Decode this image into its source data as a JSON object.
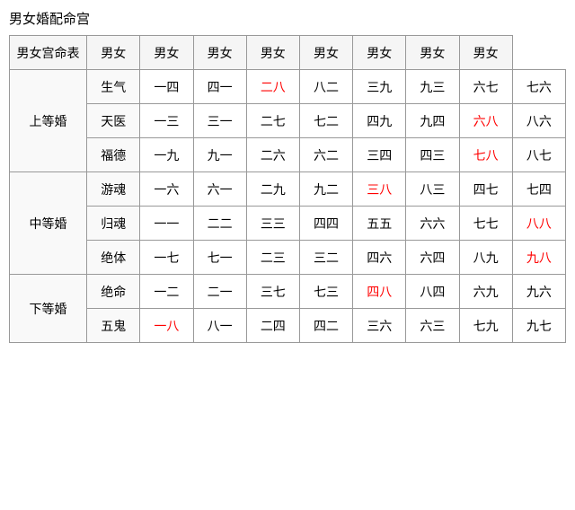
{
  "title": "男女婚配命宫",
  "table": {
    "headers": [
      "男女宫命表",
      "男女",
      "男女",
      "男女",
      "男女",
      "男女",
      "男女",
      "男女",
      "男女"
    ],
    "groups": [
      {
        "group_label": "上等婚",
        "rows": [
          {
            "row_label": "生气",
            "cells": [
              {
                "text": "一四",
                "red": false
              },
              {
                "text": "四一",
                "red": false
              },
              {
                "text": "二八",
                "red": true
              },
              {
                "text": "八二",
                "red": false
              },
              {
                "text": "三九",
                "red": false
              },
              {
                "text": "九三",
                "red": false
              },
              {
                "text": "六七",
                "red": false
              },
              {
                "text": "七六",
                "red": false
              }
            ]
          },
          {
            "row_label": "天医",
            "cells": [
              {
                "text": "一三",
                "red": false
              },
              {
                "text": "三一",
                "red": false
              },
              {
                "text": "二七",
                "red": false
              },
              {
                "text": "七二",
                "red": false
              },
              {
                "text": "四九",
                "red": false
              },
              {
                "text": "九四",
                "red": false
              },
              {
                "text": "六八",
                "red": true
              },
              {
                "text": "八六",
                "red": false
              }
            ]
          },
          {
            "row_label": "福德",
            "cells": [
              {
                "text": "一九",
                "red": false
              },
              {
                "text": "九一",
                "red": false
              },
              {
                "text": "二六",
                "red": false
              },
              {
                "text": "六二",
                "red": false
              },
              {
                "text": "三四",
                "red": false
              },
              {
                "text": "四三",
                "red": false
              },
              {
                "text": "七八",
                "red": true
              },
              {
                "text": "八七",
                "red": false
              }
            ]
          }
        ]
      },
      {
        "group_label": "中等婚",
        "rows": [
          {
            "row_label": "游魂",
            "cells": [
              {
                "text": "一六",
                "red": false
              },
              {
                "text": "六一",
                "red": false
              },
              {
                "text": "二九",
                "red": false
              },
              {
                "text": "九二",
                "red": false
              },
              {
                "text": "三八",
                "red": true
              },
              {
                "text": "八三",
                "red": false
              },
              {
                "text": "四七",
                "red": false
              },
              {
                "text": "七四",
                "red": false
              }
            ]
          },
          {
            "row_label": "归魂",
            "cells": [
              {
                "text": "一一",
                "red": false
              },
              {
                "text": "二二",
                "red": false
              },
              {
                "text": "三三",
                "red": false
              },
              {
                "text": "四四",
                "red": false
              },
              {
                "text": "五五",
                "red": false
              },
              {
                "text": "六六",
                "red": false
              },
              {
                "text": "七七",
                "red": false
              },
              {
                "text": "八八",
                "red": true
              }
            ]
          },
          {
            "row_label": "绝体",
            "cells": [
              {
                "text": "一七",
                "red": false
              },
              {
                "text": "七一",
                "red": false
              },
              {
                "text": "二三",
                "red": false
              },
              {
                "text": "三二",
                "red": false
              },
              {
                "text": "四六",
                "red": false
              },
              {
                "text": "六四",
                "red": false
              },
              {
                "text": "八九",
                "red": false
              },
              {
                "text": "九八",
                "red": true
              }
            ]
          }
        ]
      },
      {
        "group_label": "下等婚",
        "rows": [
          {
            "row_label": "绝命",
            "cells": [
              {
                "text": "一二",
                "red": false
              },
              {
                "text": "二一",
                "red": false
              },
              {
                "text": "三七",
                "red": false
              },
              {
                "text": "七三",
                "red": false
              },
              {
                "text": "四八",
                "red": true
              },
              {
                "text": "八四",
                "red": false
              },
              {
                "text": "六九",
                "red": false
              },
              {
                "text": "九六",
                "red": false
              }
            ]
          },
          {
            "row_label": "五鬼",
            "cells": [
              {
                "text": "一八",
                "red": true
              },
              {
                "text": "八一",
                "red": false
              },
              {
                "text": "二四",
                "red": false
              },
              {
                "text": "四二",
                "red": false
              },
              {
                "text": "三六",
                "red": false
              },
              {
                "text": "六三",
                "red": false
              },
              {
                "text": "七九",
                "red": false
              },
              {
                "text": "九七",
                "red": false
              }
            ]
          }
        ]
      }
    ]
  }
}
